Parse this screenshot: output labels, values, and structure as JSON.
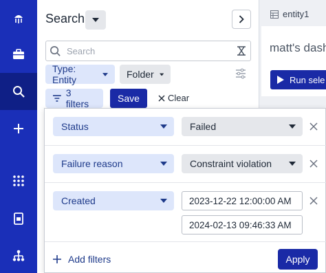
{
  "rail": {
    "items": [
      {
        "icon": "jellyfish-logo-icon"
      },
      {
        "icon": "briefcase-icon"
      },
      {
        "icon": "search-icon",
        "active": true
      },
      {
        "icon": "plus-icon"
      },
      {
        "icon": "grid-dots-icon"
      },
      {
        "icon": "document-icon"
      },
      {
        "icon": "hierarchy-icon"
      }
    ]
  },
  "panel": {
    "title": "Search",
    "search_placeholder": "Search",
    "type_chip": "Type: Entity",
    "folder_chip": "Folder",
    "filters_chip": "3 filters",
    "save_label": "Save",
    "clear_label": "Clear"
  },
  "dashboard": {
    "tab_label": "entity1",
    "title": "matt's dash",
    "run_label": "Run sele"
  },
  "filters": {
    "rows": [
      {
        "field": "Status",
        "value": "Failed"
      },
      {
        "field": "Failure reason",
        "value": "Constraint violation"
      },
      {
        "field": "Created",
        "from": "2023-12-22 12:00:00 AM",
        "to": "2024-02-13 09:46:33 AM"
      }
    ],
    "add_label": "Add filters",
    "apply_label": "Apply"
  },
  "colors": {
    "rail": "#1a2fb8",
    "rail_active": "#0f1f86",
    "primary_button": "#1a2aa6",
    "chip_blue": "#dde6fb",
    "chip_gray": "#e5e7eb"
  }
}
